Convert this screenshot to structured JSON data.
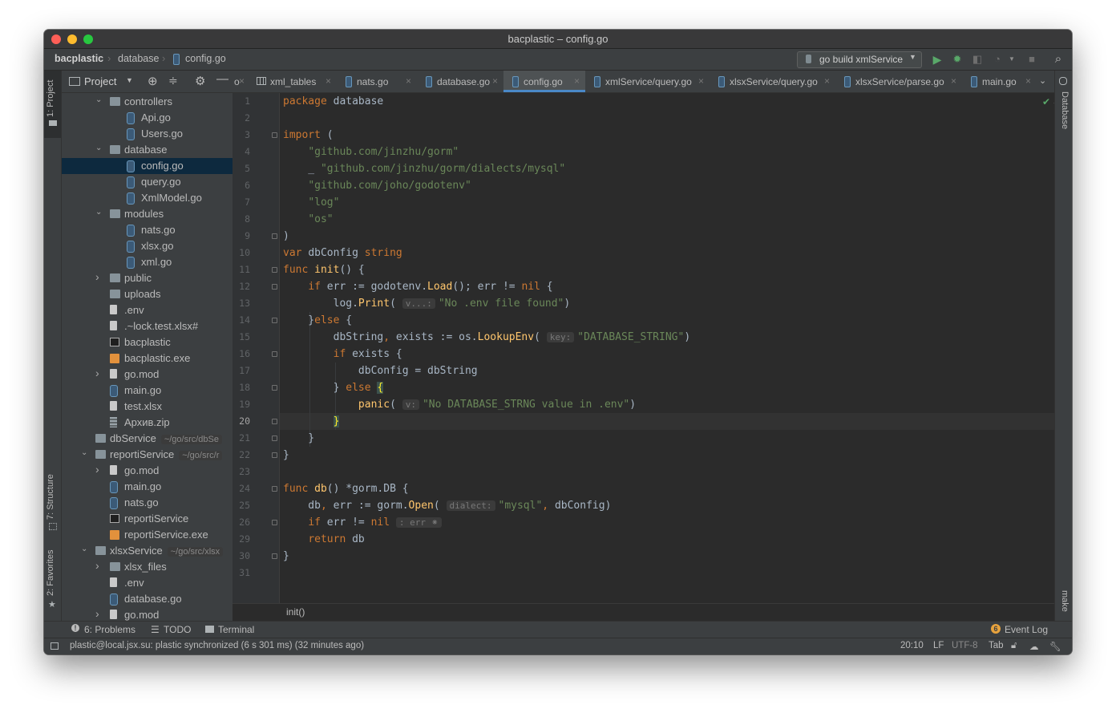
{
  "window": {
    "title": "bacplastic – config.go"
  },
  "breadcrumbs": [
    "bacplastic",
    "database",
    "config.go"
  ],
  "toolbar": {
    "run_config": "go build xmlService"
  },
  "sidebar": {
    "project_label": "Project",
    "vtabs_left": [
      "1: Project",
      "7: Structure",
      "2: Favorites"
    ],
    "vtabs_right": [
      "Database",
      "make"
    ]
  },
  "tree": [
    {
      "name": "controllers",
      "type": "folder",
      "level": 2,
      "arrow": "open"
    },
    {
      "name": "Api.go",
      "type": "go",
      "level": 3
    },
    {
      "name": "Users.go",
      "type": "go",
      "level": 3
    },
    {
      "name": "database",
      "type": "folder",
      "level": 2,
      "arrow": "open"
    },
    {
      "name": "config.go",
      "type": "go",
      "level": 3,
      "selected": true
    },
    {
      "name": "query.go",
      "type": "go",
      "level": 3
    },
    {
      "name": "XmlModel.go",
      "type": "go",
      "level": 3
    },
    {
      "name": "modules",
      "type": "folder",
      "level": 2,
      "arrow": "open"
    },
    {
      "name": "nats.go",
      "type": "go",
      "level": 3
    },
    {
      "name": "xlsx.go",
      "type": "go",
      "level": 3
    },
    {
      "name": "xml.go",
      "type": "go",
      "level": 3
    },
    {
      "name": "public",
      "type": "folder",
      "level": 2,
      "arrow": "closed"
    },
    {
      "name": "uploads",
      "type": "folder",
      "level": 2
    },
    {
      "name": ".env",
      "type": "txt",
      "level": 2
    },
    {
      "name": ".~lock.test.xlsx#",
      "type": "txt",
      "level": 2
    },
    {
      "name": "bacplastic",
      "type": "bin",
      "level": 2
    },
    {
      "name": "bacplastic.exe",
      "type": "exe",
      "level": 2
    },
    {
      "name": "go.mod",
      "type": "txt",
      "level": 2,
      "arrow": "closed"
    },
    {
      "name": "main.go",
      "type": "go",
      "level": 2
    },
    {
      "name": "test.xlsx",
      "type": "txt",
      "level": 2
    },
    {
      "name": "Архив.zip",
      "type": "zip",
      "level": 2
    },
    {
      "name": "dbService",
      "type": "folder",
      "level": 1,
      "hint": "~/go/src/dbSe"
    },
    {
      "name": "reportiService",
      "type": "folder",
      "level": 1,
      "arrow": "open",
      "hint": "~/go/src/r"
    },
    {
      "name": "go.mod",
      "type": "txt",
      "level": 2,
      "arrow": "closed"
    },
    {
      "name": "main.go",
      "type": "go",
      "level": 2
    },
    {
      "name": "nats.go",
      "type": "go",
      "level": 2
    },
    {
      "name": "reportiService",
      "type": "bin",
      "level": 2
    },
    {
      "name": "reportiService.exe",
      "type": "exe",
      "level": 2
    },
    {
      "name": "xlsxService",
      "type": "folder",
      "level": 1,
      "arrow": "open",
      "hint": "~/go/src/xlsx"
    },
    {
      "name": "xlsx_files",
      "type": "folder",
      "level": 2,
      "arrow": "closed"
    },
    {
      "name": ".env",
      "type": "txt",
      "level": 2
    },
    {
      "name": "database.go",
      "type": "go",
      "level": 2
    },
    {
      "name": "go.mod",
      "type": "txt",
      "level": 2,
      "arrow": "closed"
    }
  ],
  "tabs": [
    {
      "label": "o",
      "icon": "none"
    },
    {
      "label": "xml_tables",
      "icon": "table"
    },
    {
      "label": "nats.go",
      "icon": "go"
    },
    {
      "label": "database.go",
      "icon": "go"
    },
    {
      "label": "config.go",
      "icon": "go",
      "active": true
    },
    {
      "label": "xmlService/query.go",
      "icon": "go"
    },
    {
      "label": "xlsxService/query.go",
      "icon": "go"
    },
    {
      "label": "xlsxService/parse.go",
      "icon": "go"
    },
    {
      "label": "main.go",
      "icon": "go"
    }
  ],
  "editor": {
    "inspection_count": "1",
    "line_numbers": [
      "1",
      "2",
      "3",
      "4",
      "5",
      "6",
      "7",
      "8",
      "9",
      "10",
      "11",
      "12",
      "13",
      "14",
      "15",
      "16",
      "17",
      "18",
      "19",
      "20",
      "21",
      "22",
      "23",
      "24",
      "25",
      "26",
      "29",
      "30",
      "31"
    ],
    "current_line": "20",
    "code": [
      [
        [
          "kw",
          "package "
        ],
        [
          "id",
          "database"
        ]
      ],
      [],
      [
        [
          "kw",
          "import "
        ],
        [
          "id",
          "("
        ]
      ],
      [
        [
          "id",
          "    "
        ],
        [
          "str",
          "\"github.com/jinzhu/gorm\""
        ]
      ],
      [
        [
          "id",
          "    _ "
        ],
        [
          "str",
          "\"github.com/jinzhu/gorm/dialects/mysql\""
        ]
      ],
      [
        [
          "id",
          "    "
        ],
        [
          "str",
          "\"github.com/joho/godotenv\""
        ]
      ],
      [
        [
          "id",
          "    "
        ],
        [
          "str",
          "\"log\""
        ]
      ],
      [
        [
          "id",
          "    "
        ],
        [
          "str",
          "\"os\""
        ]
      ],
      [
        [
          "id",
          ")"
        ]
      ],
      [
        [
          "kw",
          "var "
        ],
        [
          "id",
          "dbConfig "
        ],
        [
          "kw",
          "string"
        ]
      ],
      [
        [
          "kw",
          "func "
        ],
        [
          "fn",
          "init"
        ],
        [
          "id",
          "() {"
        ]
      ],
      [
        [
          "id",
          "    "
        ],
        [
          "kw",
          "if "
        ],
        [
          "id",
          "err := godotenv."
        ],
        [
          "fn",
          "Load"
        ],
        [
          "id",
          "(); err != "
        ],
        [
          "kw",
          "nil "
        ],
        [
          "id",
          "{"
        ]
      ],
      [
        [
          "id",
          "        log."
        ],
        [
          "fn",
          "Print"
        ],
        [
          "id",
          "( "
        ],
        [
          "hint",
          "v...:"
        ],
        [
          "str",
          "\"No .env file found\""
        ],
        [
          "id",
          ")"
        ]
      ],
      [
        [
          "id",
          "    }"
        ],
        [
          "kw",
          "else "
        ],
        [
          "id",
          "{"
        ]
      ],
      [
        [
          "id",
          "        dbString"
        ],
        [
          "kw",
          ", "
        ],
        [
          "id",
          "exists := os."
        ],
        [
          "fn",
          "LookupEnv"
        ],
        [
          "id",
          "( "
        ],
        [
          "hint",
          "key:"
        ],
        [
          "str",
          "\"DATABASE_STRING\""
        ],
        [
          "id",
          ")"
        ]
      ],
      [
        [
          "id",
          "        "
        ],
        [
          "kw",
          "if "
        ],
        [
          "id",
          "exists {"
        ]
      ],
      [
        [
          "id",
          "            dbConfig = dbString"
        ]
      ],
      [
        [
          "id",
          "        } "
        ],
        [
          "kw",
          "else "
        ],
        [
          "bh",
          "{"
        ]
      ],
      [
        [
          "id",
          "            "
        ],
        [
          "fn",
          "panic"
        ],
        [
          "id",
          "( "
        ],
        [
          "hint",
          "v:"
        ],
        [
          "str",
          "\"No DATABASE_STRNG value in .env\""
        ],
        [
          "id",
          ")"
        ]
      ],
      [
        [
          "id",
          "        "
        ],
        [
          "bh",
          "}"
        ]
      ],
      [
        [
          "id",
          "    }"
        ]
      ],
      [
        [
          "id",
          "}"
        ]
      ],
      [],
      [
        [
          "kw",
          "func "
        ],
        [
          "fn",
          "db"
        ],
        [
          "id",
          "() *gorm.DB {"
        ]
      ],
      [
        [
          "id",
          "    db"
        ],
        [
          "kw",
          ", "
        ],
        [
          "id",
          "err := gorm."
        ],
        [
          "fn",
          "Open"
        ],
        [
          "id",
          "( "
        ],
        [
          "hint",
          "dialect:"
        ],
        [
          "str",
          "\"mysql\""
        ],
        [
          "kw",
          ", "
        ],
        [
          "id",
          "dbConfig)"
        ]
      ],
      [
        [
          "id",
          "    "
        ],
        [
          "kw",
          "if "
        ],
        [
          "id",
          "err != "
        ],
        [
          "kw",
          "nil "
        ],
        [
          "hint",
          ": err ⁕"
        ]
      ],
      [
        [
          "id",
          "    "
        ],
        [
          "kw",
          "return "
        ],
        [
          "id",
          "db"
        ]
      ],
      [
        [
          "id",
          "}"
        ]
      ],
      []
    ],
    "breadcrumb": "init()"
  },
  "toolwindows": {
    "problems": "6: Problems",
    "todo": "TODO",
    "terminal": "Terminal",
    "event_log": "Event Log",
    "event_count": "6"
  },
  "status": {
    "message": "plastic@local.jsx.su: plastic synchronized (6 s 301 ms) (32 minutes ago)",
    "position": "20:10",
    "line_sep": "LF",
    "encoding": "UTF-8",
    "indent": "Tab"
  },
  "colors": {
    "keyword": "#cc7832",
    "string": "#6a8759",
    "function": "#ffc66d",
    "text": "#a9b7c6",
    "selection": "#0d293e",
    "accent": "#4a88c7"
  }
}
